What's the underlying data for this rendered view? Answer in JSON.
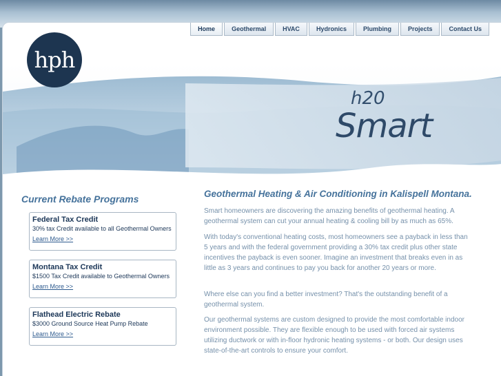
{
  "nav": {
    "items": [
      "Home",
      "Geothermal",
      "HVAC",
      "Hydronics",
      "Plumbing",
      "Projects",
      "Contact Us"
    ]
  },
  "logo": {
    "text": "hph"
  },
  "hero": {
    "brand_line1": "h20",
    "brand_line2": "Smart"
  },
  "sidebar": {
    "title": "Current Rebate Programs",
    "cards": [
      {
        "title": "Federal Tax Credit",
        "desc": "30% tax Credit available to all Geothermal Owners",
        "link": "Learn More >>"
      },
      {
        "title": "Montana Tax Credit",
        "desc": "$1500 Tax Credit available to Geothermal Owners",
        "link": "Learn More >>"
      },
      {
        "title": "Flathead Electric Rebate",
        "desc": "$3000 Ground Source Heat Pump Rebate",
        "link": "Learn More >>"
      }
    ]
  },
  "main": {
    "title": "Geothermal Heating & Air Conditioning in Kalispell Montana.",
    "paragraphs": [
      "Smart homeowners are discovering the amazing benefits of geothermal heating. A geothermal system can cut your annual heating & cooling bill by as much as 65%.",
      "With today's conventional heating costs, most homeowners see a payback in less than 5 years and with the federal government providing a 30% tax credit plus other state incentives the payback is even sooner. Imagine an investment that breaks even in as little as 3 years and continues to pay you back for another 20 years or more.",
      "Where else can you find a better investment? That's the outstanding benefit of a geothermal system.",
      "Our geothermal systems are custom designed to provide the most comfortable indoor environment possible. They are flexible enough to be used with forced air systems utilizing ductwork or with in-floor hydronic heating systems - or both. Our design uses state-of-the-art controls to ensure your comfort."
    ]
  },
  "colors": {
    "accent": "#45729b",
    "navy": "#1d3550",
    "body_text": "#7590aa"
  }
}
